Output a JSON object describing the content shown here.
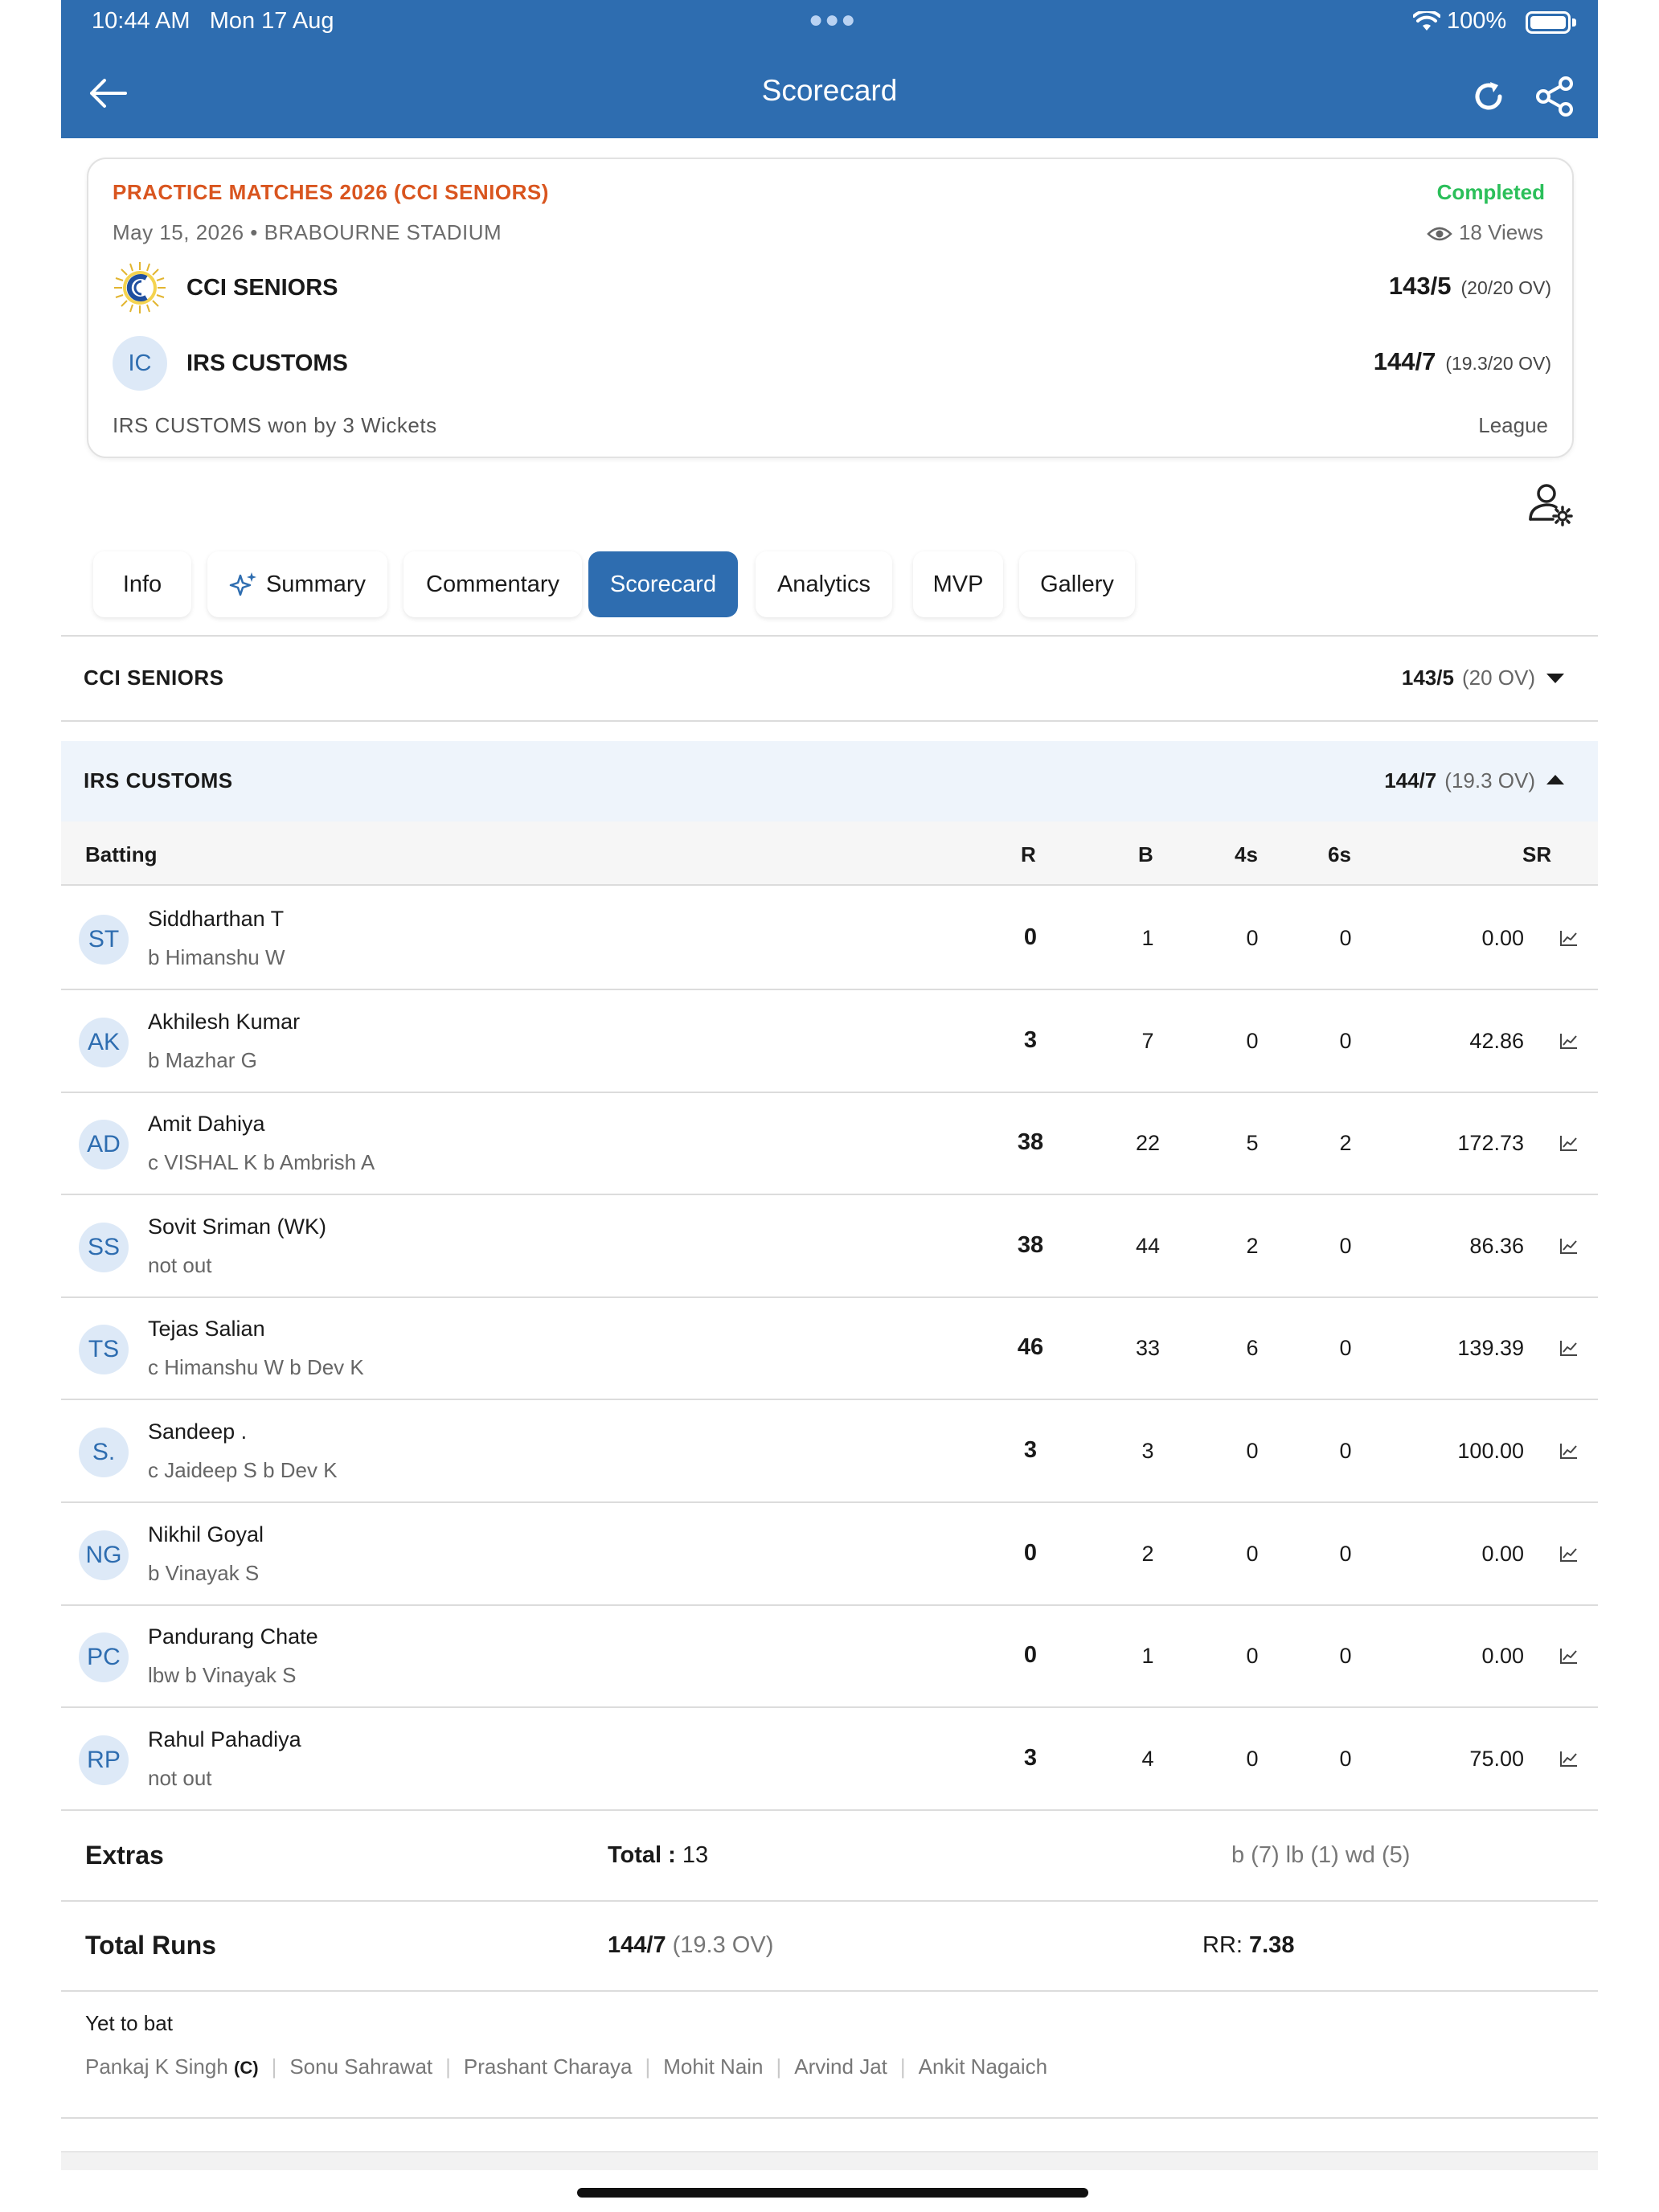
{
  "status_bar": {
    "time": "10:44 AM",
    "date": "Mon 17 Aug",
    "battery": "100%"
  },
  "header": {
    "title": "Scorecard"
  },
  "match": {
    "tournament": "PRACTICE MATCHES 2026 (CCI SENIORS)",
    "status": "Completed",
    "date": "May 15, 2026",
    "venue": "BRABOURNE STADIUM",
    "views": "18 Views",
    "team1": {
      "name": "CCI SENIORS",
      "score": "143/5",
      "overs": "(20/20 OV)"
    },
    "team2": {
      "name": "IRS CUSTOMS",
      "initials": "IC",
      "score": "144/7",
      "overs": "(19.3/20 OV)"
    },
    "result": "IRS CUSTOMS won by 3 Wickets",
    "type": "League"
  },
  "tabs": [
    "Info",
    "Summary",
    "Commentary",
    "Scorecard",
    "Analytics",
    "MVP",
    "Gallery"
  ],
  "innings": [
    {
      "team": "CCI SENIORS",
      "score": "143/5",
      "overs": "(20 OV)"
    },
    {
      "team": "IRS CUSTOMS",
      "score": "144/7",
      "overs": "(19.3 OV)"
    }
  ],
  "batting": {
    "headers": {
      "batting": "Batting",
      "r": "R",
      "b": "B",
      "fours": "4s",
      "sixes": "6s",
      "sr": "SR"
    },
    "rows": [
      {
        "initials": "ST",
        "name": "Siddharthan T",
        "dismissal": "b Himanshu W",
        "r": "0",
        "b": "1",
        "fours": "0",
        "sixes": "0",
        "sr": "0.00"
      },
      {
        "initials": "AK",
        "name": "Akhilesh Kumar",
        "dismissal": "b Mazhar G",
        "r": "3",
        "b": "7",
        "fours": "0",
        "sixes": "0",
        "sr": "42.86"
      },
      {
        "initials": "AD",
        "name": "Amit Dahiya",
        "dismissal": "c VISHAL K b Ambrish A",
        "r": "38",
        "b": "22",
        "fours": "5",
        "sixes": "2",
        "sr": "172.73"
      },
      {
        "initials": "SS",
        "name": "Sovit Sriman  (WK)",
        "dismissal": "not out",
        "r": "38",
        "b": "44",
        "fours": "2",
        "sixes": "0",
        "sr": "86.36"
      },
      {
        "initials": "TS",
        "name": "Tejas Salian",
        "dismissal": "c Himanshu W b Dev K",
        "r": "46",
        "b": "33",
        "fours": "6",
        "sixes": "0",
        "sr": "139.39"
      },
      {
        "initials": "S.",
        "name": "Sandeep .",
        "dismissal": "c Jaideep S b Dev K",
        "r": "3",
        "b": "3",
        "fours": "0",
        "sixes": "0",
        "sr": "100.00"
      },
      {
        "initials": "NG",
        "name": "Nikhil Goyal",
        "dismissal": "b Vinayak S",
        "r": "0",
        "b": "2",
        "fours": "0",
        "sixes": "0",
        "sr": "0.00"
      },
      {
        "initials": "PC",
        "name": "Pandurang Chate",
        "dismissal": "lbw b Vinayak S",
        "r": "0",
        "b": "1",
        "fours": "0",
        "sixes": "0",
        "sr": "0.00"
      },
      {
        "initials": "RP",
        "name": "Rahul Pahadiya",
        "dismissal": "not out",
        "r": "3",
        "b": "4",
        "fours": "0",
        "sixes": "0",
        "sr": "75.00"
      }
    ]
  },
  "extras": {
    "label": "Extras",
    "total_label": "Total : ",
    "total": "13",
    "breakdown": "b (7) lb (1) wd (5)"
  },
  "totals": {
    "label": "Total Runs",
    "score": "144/7",
    "overs": "(19.3 OV)",
    "rr_label": "RR: ",
    "rr": "7.38"
  },
  "yet_to_bat": {
    "title": "Yet to bat",
    "players": [
      "Pankaj K Singh",
      "Sonu Sahrawat",
      "Prashant Charaya",
      "Mohit Nain",
      "Arvind Jat",
      "Ankit Nagaich"
    ],
    "captain_tag": "(C)"
  },
  "colors": {
    "header_blue": "#2e6db0",
    "tournament_orange": "#d9551f",
    "completed_green": "#2bbf5a"
  }
}
